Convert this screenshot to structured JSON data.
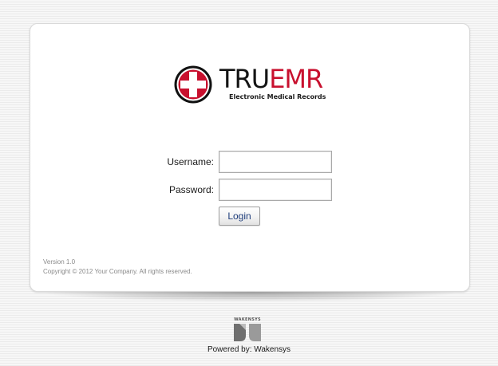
{
  "brand": {
    "name_part1": "TRU",
    "name_part2": "EMR",
    "tagline": "Electronic Medical Records",
    "accent_color": "#c8102e",
    "logo_icon": "medical-cross-icon"
  },
  "login_form": {
    "username_label": "Username:",
    "username_value": "",
    "password_label": "Password:",
    "password_value": "",
    "login_button_label": "Login"
  },
  "card_footer": {
    "version": "Version 1.0",
    "copyright": "Copyright © 2012 Your Company. All rights reserved."
  },
  "page_footer": {
    "vendor_logo_text": "WAKENSYS",
    "powered_by": "Powered by: Wakensys"
  }
}
